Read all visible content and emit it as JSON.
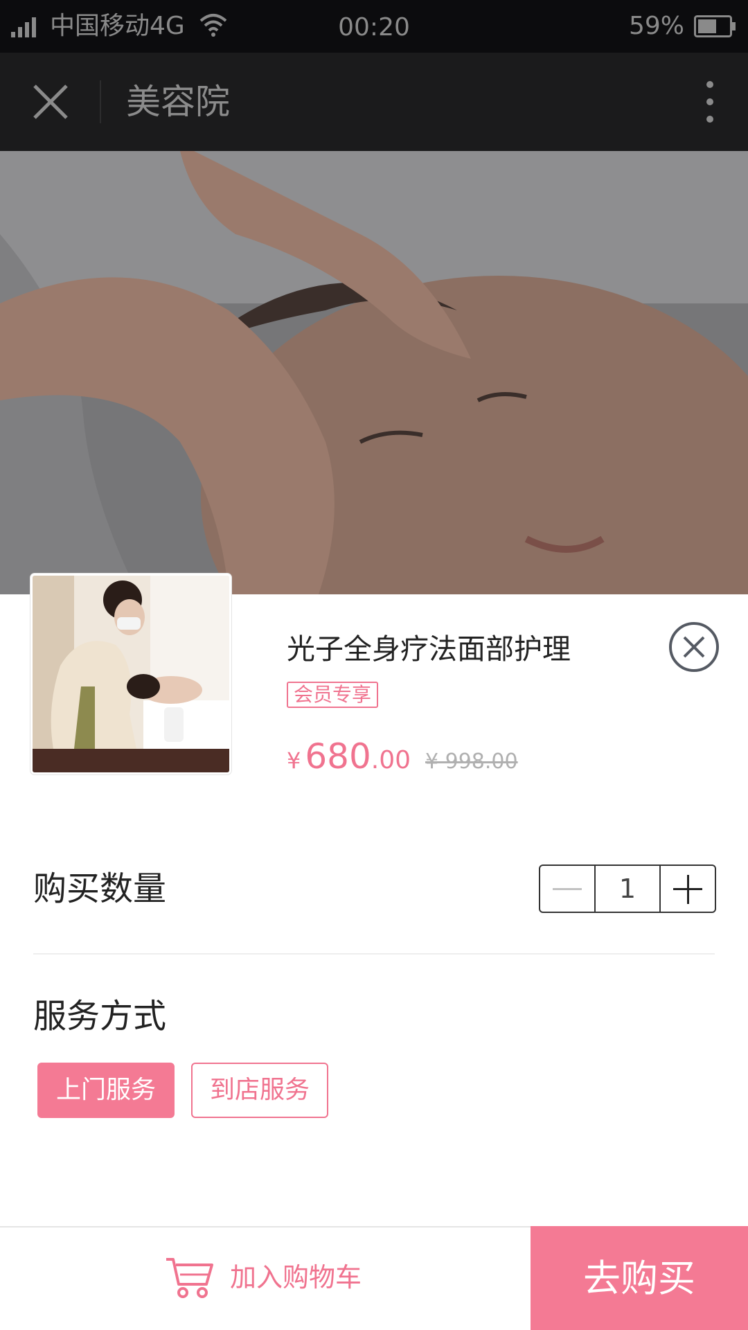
{
  "status_bar": {
    "carrier": "中国移动4G",
    "time": "00:20",
    "battery": "59%"
  },
  "nav": {
    "title": "美容院",
    "close_icon": "close-icon",
    "more_icon": "more-vertical-icon"
  },
  "product": {
    "name": "光子全身疗法面部护理",
    "badge": "会员专享",
    "price_symbol": "¥",
    "price_integer": "680",
    "price_decimal": ".00",
    "original_price": "¥ 998.00"
  },
  "quantity": {
    "label": "购买数量",
    "value": "1"
  },
  "service": {
    "label": "服务方式",
    "options": [
      {
        "label": "上门服务",
        "selected": true
      },
      {
        "label": "到店服务",
        "selected": false
      }
    ]
  },
  "actions": {
    "add_to_cart": "加入购物车",
    "buy_now": "去购买"
  },
  "colors": {
    "accent": "#f47a94",
    "nav_background": "#1b1b1c",
    "status_background": "#0c0c0e"
  }
}
